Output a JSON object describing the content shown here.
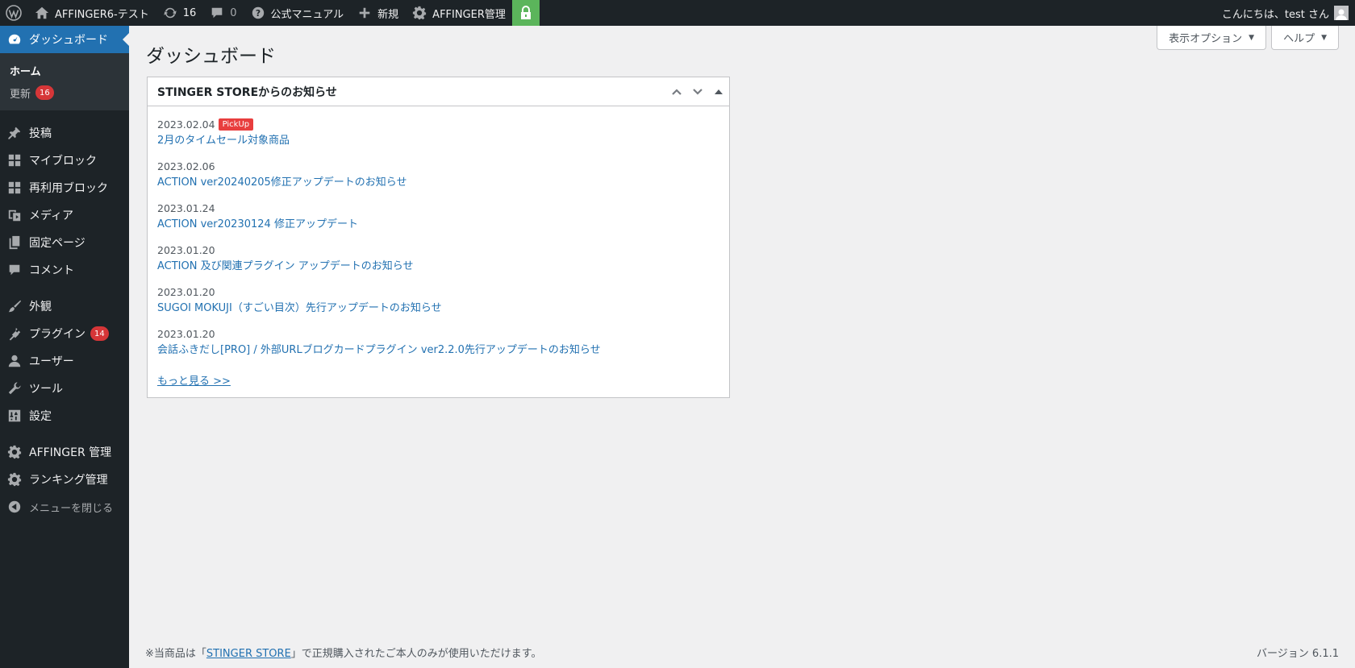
{
  "adminbar": {
    "site_name": "AFFINGER6-テスト",
    "updates_count": "16",
    "comments_count": "0",
    "manual_label": "公式マニュアル",
    "new_label": "新規",
    "affinger_label": "AFFINGER管理",
    "greeting": "こんにちは、test さん"
  },
  "sidebar": {
    "dashboard": "ダッシュボード",
    "home": "ホーム",
    "updates": "更新",
    "updates_badge": "16",
    "posts": "投稿",
    "myblock": "マイブロック",
    "reusable": "再利用ブロック",
    "media": "メディア",
    "pages": "固定ページ",
    "comments": "コメント",
    "appearance": "外観",
    "plugins": "プラグイン",
    "plugins_badge": "14",
    "users": "ユーザー",
    "tools": "ツール",
    "settings": "設定",
    "affinger": "AFFINGER 管理",
    "ranking": "ランキング管理",
    "collapse": "メニューを閉じる"
  },
  "header": {
    "screen_options": "表示オプション",
    "help": "ヘルプ",
    "page_title": "ダッシュボード"
  },
  "widget": {
    "title": "STINGER STOREからのお知らせ",
    "pickup_label": "PickUp",
    "items": [
      {
        "date": "2023.02.04",
        "title": "2月のタイムセール対象商品"
      },
      {
        "date": "2023.02.06",
        "title": "ACTION ver20240205修正アップデートのお知らせ"
      },
      {
        "date": "2023.01.24",
        "title": "ACTION ver20230124 修正アップデート"
      },
      {
        "date": "2023.01.20",
        "title": "ACTION 及び関連プラグイン アップデートのお知らせ"
      },
      {
        "date": "2023.01.20",
        "title": "SUGOI MOKUJI（すごい目次）先行アップデートのお知らせ"
      },
      {
        "date": "2023.01.20",
        "title": "会話ふきだし[PRO] / 外部URLブログカードプラグイン ver2.2.0先行アップデートのお知らせ"
      }
    ],
    "more_link": "もっと見る >>"
  },
  "footer": {
    "note_prefix": "※当商品は「",
    "store_link": "STINGER STORE",
    "note_suffix": "」で正規購入されたご本人のみが使用いただけます。",
    "version": "バージョン 6.1.1"
  },
  "colors": {
    "adminbar_bg": "#1d2327",
    "accent": "#2271b1",
    "badge": "#d63638",
    "pickup": "#e83e3e",
    "lock_bg": "#5bb55b"
  }
}
